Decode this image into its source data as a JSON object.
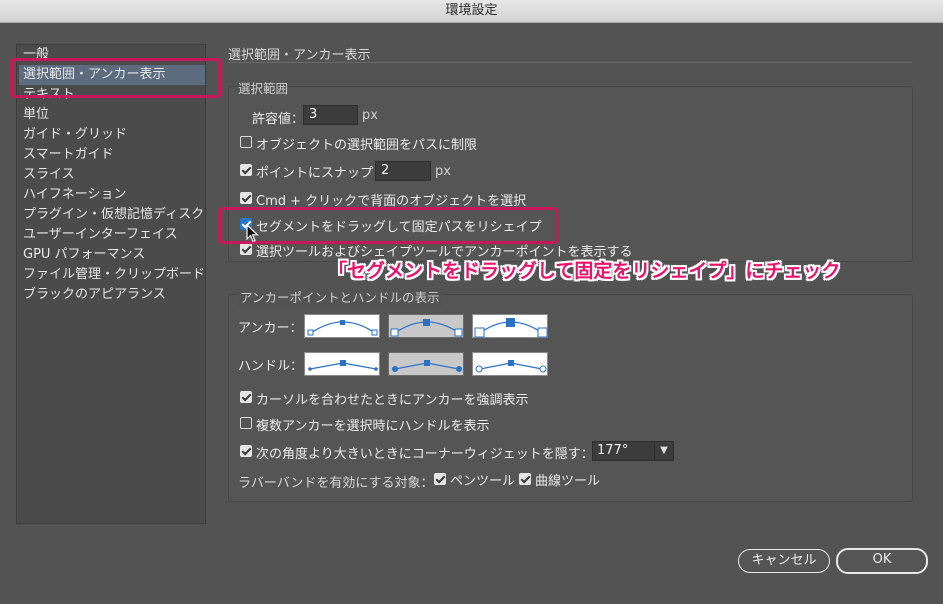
{
  "window": {
    "title": "環境設定"
  },
  "sidebar": {
    "items": [
      {
        "label": "一般"
      },
      {
        "label": "選択範囲・アンカー表示",
        "selected": true
      },
      {
        "label": "テキスト"
      },
      {
        "label": "単位"
      },
      {
        "label": "ガイド・グリッド"
      },
      {
        "label": "スマートガイド"
      },
      {
        "label": "スライス"
      },
      {
        "label": "ハイフネーション"
      },
      {
        "label": "プラグイン・仮想記憶ディスク"
      },
      {
        "label": "ユーザーインターフェイス"
      },
      {
        "label": "GPU パフォーマンス"
      },
      {
        "label": "ファイル管理・クリップボード"
      },
      {
        "label": "ブラックのアピアランス"
      }
    ]
  },
  "main": {
    "section_title": "選択範囲・アンカー表示",
    "selection": {
      "group_label": "選択範囲",
      "tolerance_label": "許容値：",
      "tolerance_value": "3",
      "tolerance_unit": "px",
      "opt_path_only": {
        "label": "オブジェクトの選択範囲をパスに制限",
        "checked": false
      },
      "opt_snap_point": {
        "label": "ポイントにスナップ",
        "checked": true
      },
      "snap_value": "2",
      "snap_unit": "px",
      "opt_cmd_click": {
        "label": "Cmd + クリックで背面のオブジェクトを選択",
        "checked": true
      },
      "opt_reshape": {
        "label": "セグメントをドラッグして固定パスをリシェイプ",
        "checked": true
      },
      "opt_show_anchors": {
        "label": "選択ツールおよびシェイプツールでアンカーポイントを表示する",
        "checked": true
      }
    },
    "anchor_display": {
      "group_label": "アンカーポイントとハンドルの表示",
      "anchor_label": "アンカー：",
      "handle_label": "ハンドル：",
      "opt_highlight": {
        "label": "カーソルを合わせたときにアンカーを強調表示",
        "checked": true
      },
      "opt_multi_handles": {
        "label": "複数アンカーを選択時にハンドルを表示",
        "checked": false
      },
      "opt_hide_corner": {
        "label": "次の角度より大きいときにコーナーウィジェットを隠す：",
        "checked": true
      },
      "angle_value": "177°",
      "rubber_label": "ラバーバンドを有効にする対象：",
      "opt_pen": {
        "label": "ペンツール",
        "checked": true
      },
      "opt_curvature": {
        "label": "曲線ツール",
        "checked": true
      }
    }
  },
  "annotation": {
    "text": "「セグメントをドラッグして固定をリシェイプ」にチェック",
    "color": "#e8126a"
  },
  "buttons": {
    "cancel": "キャンセル",
    "ok": "OK"
  }
}
